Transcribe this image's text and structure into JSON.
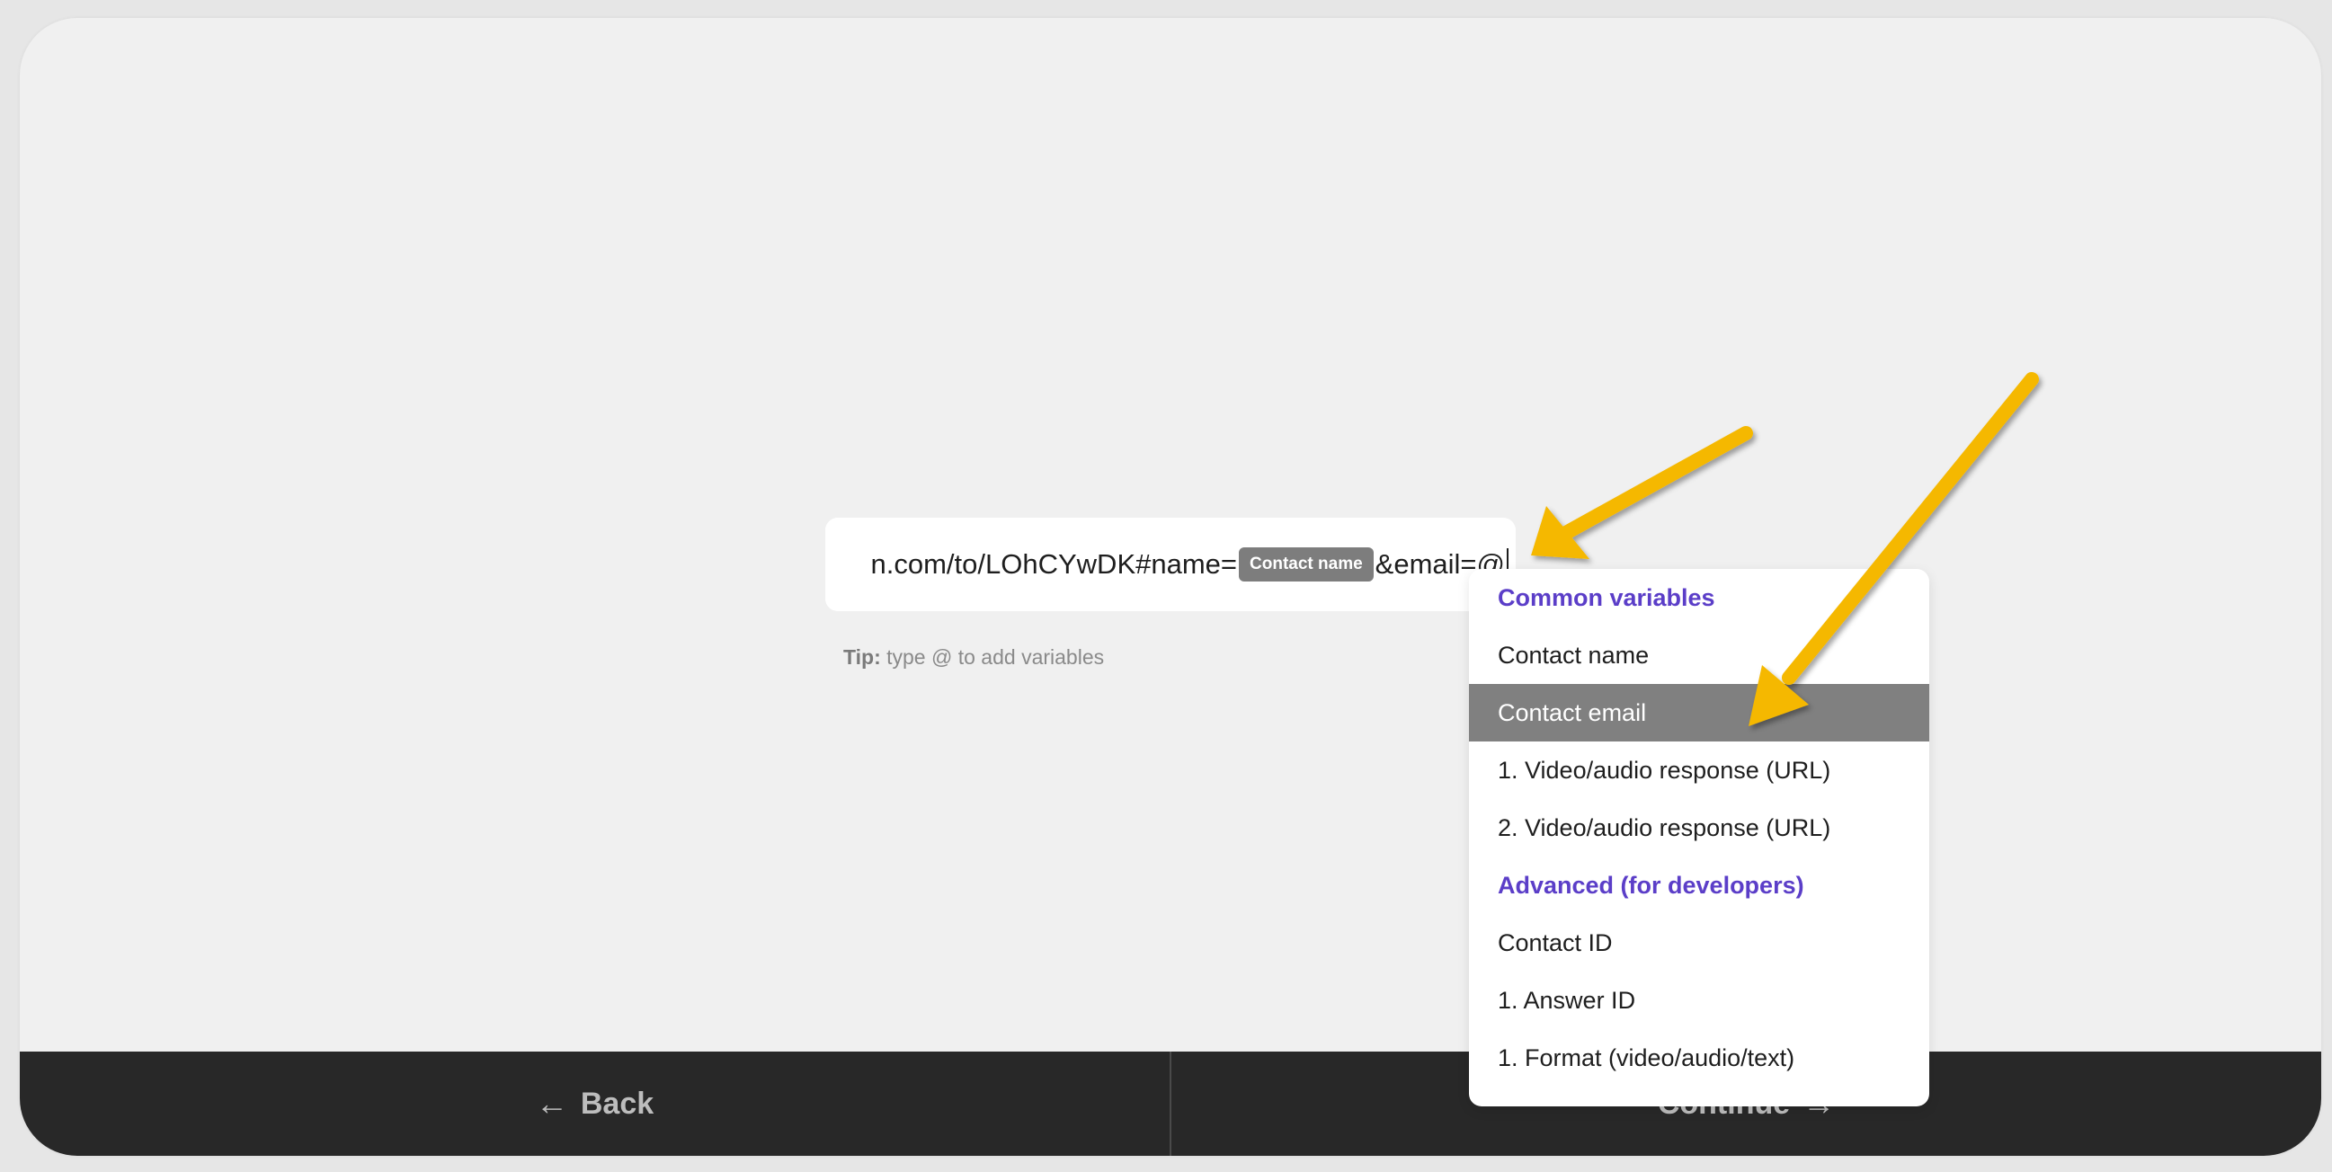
{
  "url_field": {
    "text_before": "n.com/to/LOhCYwDK#name=",
    "chip": "Contact name",
    "text_after": "&email=@"
  },
  "tip": {
    "label": "Tip:",
    "text": "type @ to add variables"
  },
  "dropdown": {
    "items": [
      {
        "label": "Common variables",
        "kind": "header"
      },
      {
        "label": "Contact name",
        "kind": "option"
      },
      {
        "label": "Contact email",
        "kind": "option",
        "selected": true
      },
      {
        "label": "1. Video/audio response (URL)",
        "kind": "option"
      },
      {
        "label": "2. Video/audio response (URL)",
        "kind": "option"
      },
      {
        "label": "Advanced (for developers)",
        "kind": "header"
      },
      {
        "label": "Contact ID",
        "kind": "option"
      },
      {
        "label": "1. Answer ID",
        "kind": "option"
      },
      {
        "label": "1. Format (video/audio/text)",
        "kind": "option"
      }
    ]
  },
  "footer": {
    "back_label": "Back",
    "continue_label": "Continue"
  },
  "icons": {
    "back": "arrow-left-icon",
    "continue": "arrow-right-icon"
  },
  "colors": {
    "accent": "#5b3ec8",
    "annotation_arrow": "#f5b800",
    "footer_bg": "#282828",
    "selected_bg": "#808080"
  }
}
